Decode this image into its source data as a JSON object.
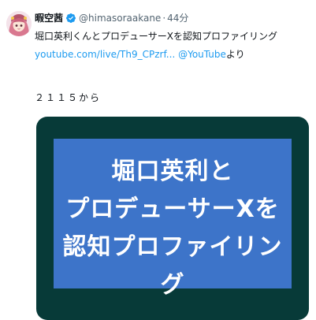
{
  "tweet": {
    "display_name": "暇空茜",
    "handle": "@himasoraakane",
    "separator": "·",
    "time": "44分",
    "text": "堀口英利くんとプロデューサーXを認知プロファイリング",
    "link_text": "youtube.com/live/Th9_CPzrf...",
    "link_via": "@YouTube",
    "link_suffix": "より",
    "timecode": "２１１５から"
  },
  "media": {
    "thumbnail_lines": [
      "堀口英利と",
      "プロデューサーXを",
      "認知プロファイリング"
    ]
  },
  "colors": {
    "link": "#1d9bf0",
    "verified": "#1d9bf0",
    "card_frame": "#073a38",
    "card_inner": "#3d74c9"
  },
  "icons": {
    "verified": "verified-badge-icon",
    "avatar": "avatar-image"
  }
}
